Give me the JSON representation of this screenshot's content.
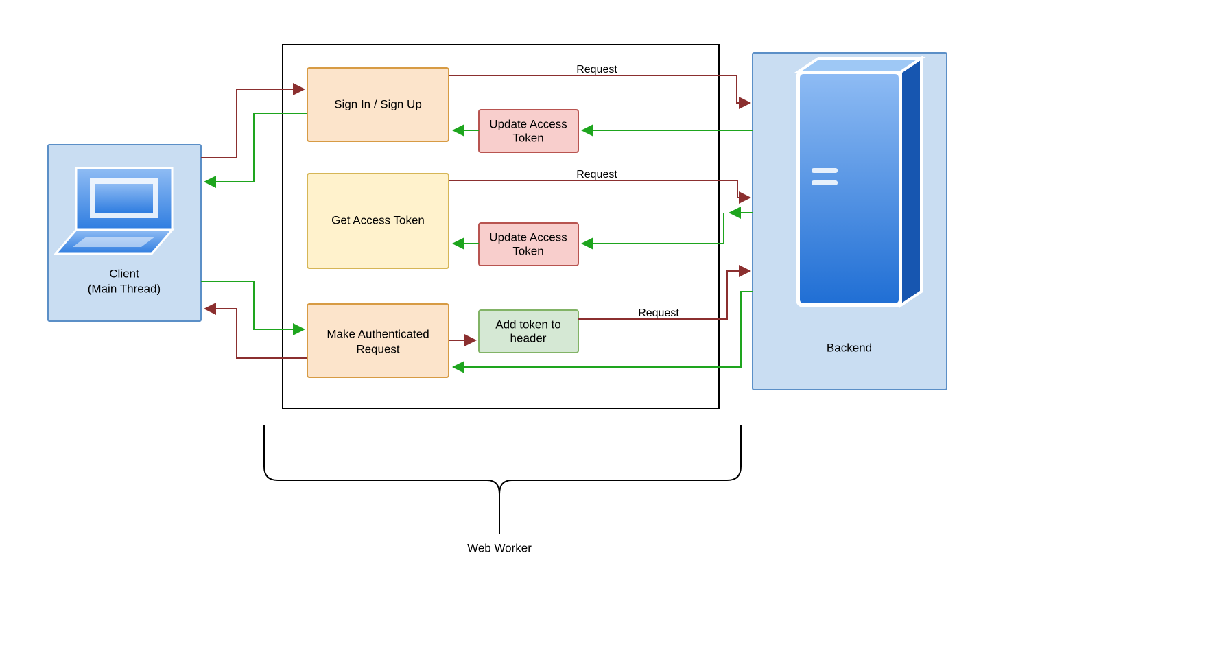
{
  "client": {
    "label_line1": "Client",
    "label_line2": "(Main Thread)"
  },
  "backend": {
    "label": "Backend"
  },
  "boxes": {
    "signin": "Sign In / Sign Up",
    "getToken": "Get Access Token",
    "makeAuth_line1": "Make Authenticated",
    "makeAuth_line2": "Request",
    "updateToken1_line1": "Update Access",
    "updateToken1_line2": "Token",
    "updateToken2_line1": "Update Access",
    "updateToken2_line2": "Token",
    "addHeader_line1": "Add token to",
    "addHeader_line2": "header"
  },
  "edges": {
    "request1": "Request",
    "request2": "Request",
    "request3": "Request"
  },
  "webWorker": {
    "label": "Web Worker"
  },
  "colors": {
    "clientFill": "#C9DDF2",
    "clientStroke": "#5B8FC7",
    "orangeFill": "#FCE4CB",
    "orangeStroke": "#D79B44",
    "yellowFill": "#FFF2CC",
    "yellowStroke": "#D6B656",
    "redFill": "#F8CECC",
    "redStroke": "#B85450",
    "greenFill": "#D5E8D4",
    "greenStroke": "#82B366",
    "redArrow": "#8B2F2F",
    "greenArrow": "#1EA51E",
    "black": "#000000"
  }
}
